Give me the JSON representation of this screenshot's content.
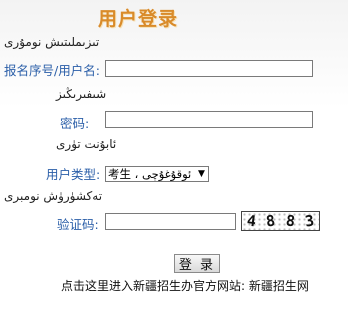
{
  "header": {
    "title": "用户登录",
    "title_uy": "تىزىملىتىش نومۇرى"
  },
  "form": {
    "reg_label": "报名序号/用户名:",
    "reg_uy": "شىفىرىڭىز",
    "reg_value": "",
    "password_label": "密码:",
    "password_uy": "ئابۇنت تۈرى",
    "password_value": "",
    "usertype_label": "用户类型:",
    "usertype_uy": "تەكشۈرۈش نومبرى",
    "usertype_selected": "考生 ، ئوقۇغۇچى",
    "captcha_label": "验证码:",
    "captcha_value": "",
    "captcha_text": "4883",
    "login_button": "登 录"
  },
  "footer": {
    "text": "点击这里进入新疆招生办官方网站: 新疆招生网"
  },
  "colors": {
    "title": "#d98b2a",
    "label": "#2a5ea8"
  }
}
